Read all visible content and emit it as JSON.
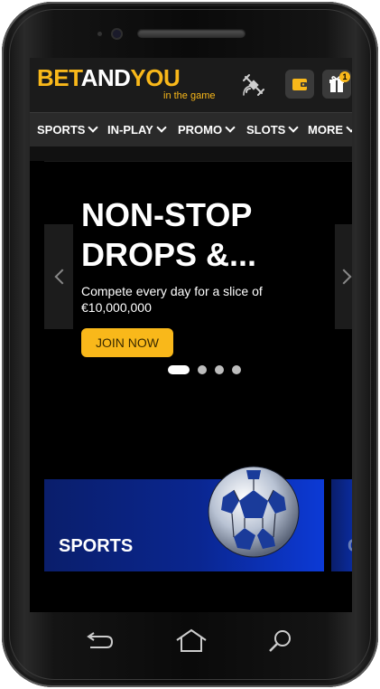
{
  "header": {
    "logo": {
      "part1": "BET",
      "part2": "AND",
      "part3": "YOU",
      "tagline": "in the game"
    },
    "wallet_icon": "wallet-icon",
    "gift_icon": "gift-icon",
    "gift_badge": "1",
    "satellite_icon": "satellite-icon"
  },
  "nav": {
    "items": [
      {
        "label": "SPORTS"
      },
      {
        "label": "IN-PLAY"
      },
      {
        "label": "PROMO"
      },
      {
        "label": "SLOTS"
      },
      {
        "label": "MORE"
      }
    ]
  },
  "banner": {
    "title": "NON-STOP DROPS &...",
    "subtitle": "Compete every day for a slice of €10,000,000",
    "cta": "JOIN NOW",
    "slides": 4,
    "active_slide": 1
  },
  "cards": [
    {
      "title": "SPORTS"
    },
    {
      "title": "C"
    }
  ],
  "colors": {
    "brand_yellow": "#f9b81a",
    "header_bg": "#1b1b1b",
    "nav_bg": "#2a2a2a",
    "card_blue": "#0a2690"
  }
}
